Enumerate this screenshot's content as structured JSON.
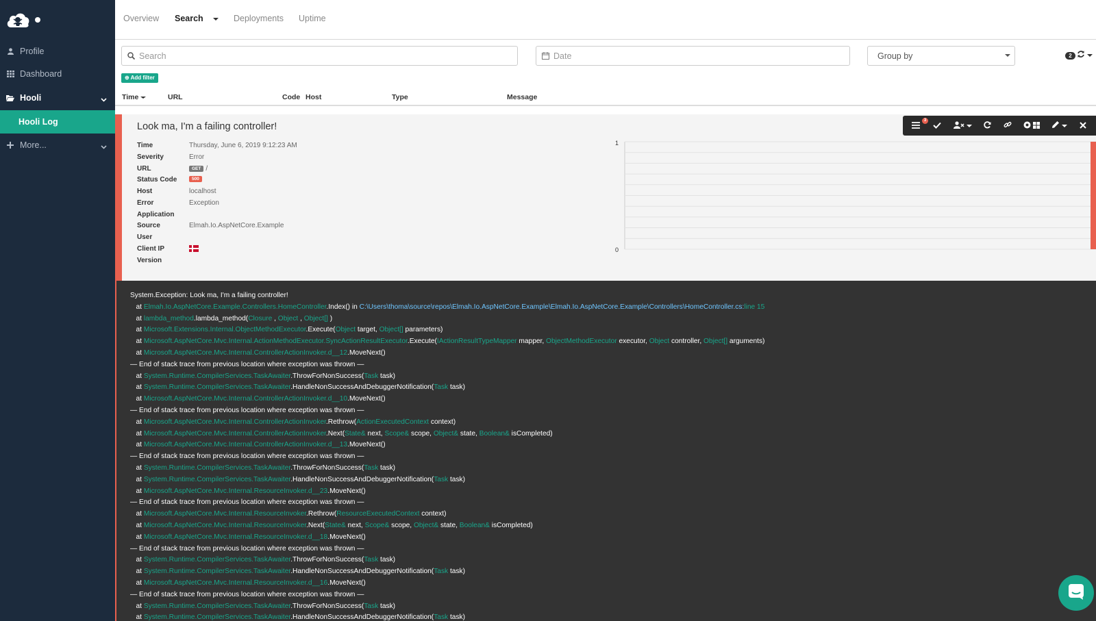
{
  "colors": {
    "sidebar_bg": "#1c2b3d",
    "accent": "#19a68b",
    "error": "#e8604f",
    "stack_bg": "#333333"
  },
  "sidebar": {
    "items": [
      {
        "label": "Profile",
        "icon": "user-icon"
      },
      {
        "label": "Dashboard",
        "icon": "grid-icon"
      },
      {
        "label": "Hooli",
        "icon": "folder-open-icon"
      },
      {
        "label": "Hooli Log",
        "active": true
      },
      {
        "label": "More...",
        "icon": "plus-icon"
      }
    ]
  },
  "header": {
    "tabs": [
      {
        "label": "Overview"
      },
      {
        "label": "Search",
        "active": true
      },
      {
        "label": "Deployments"
      },
      {
        "label": "Uptime"
      }
    ]
  },
  "filters": {
    "search_placeholder": "Search",
    "date_placeholder": "Date",
    "group_by": "Group by",
    "count": "2",
    "add_filter": "Add filter"
  },
  "table": {
    "columns": [
      "Time",
      "URL",
      "Code",
      "Host",
      "Type",
      "Message"
    ]
  },
  "toolbar": {
    "badge": "3"
  },
  "log": {
    "title": "Look ma, I'm a failing controller!",
    "fields": [
      {
        "label": "Time",
        "value": "Thursday, June 6, 2019 9:12:23 AM"
      },
      {
        "label": "Severity",
        "value": "Error"
      },
      {
        "label": "URL",
        "method": "GET",
        "value": "/"
      },
      {
        "label": "Status Code",
        "badge": "500"
      },
      {
        "label": "Host",
        "value": "localhost"
      },
      {
        "label": "Error",
        "value": "Exception"
      },
      {
        "label": "Application",
        "value": ""
      },
      {
        "label": "Source",
        "value": "Elmah.Io.AspNetCore.Example"
      },
      {
        "label": "User",
        "value": ""
      },
      {
        "label": "Client IP",
        "flag": "denmark-flag-icon"
      },
      {
        "label": "Version",
        "value": ""
      }
    ]
  },
  "chart_data": {
    "type": "bar",
    "y_ticks": [
      "1",
      "0"
    ],
    "ylim": [
      0,
      1
    ],
    "values": [
      0,
      0,
      0,
      0,
      0,
      0,
      0,
      0,
      0,
      0,
      0,
      0,
      0,
      0,
      0,
      0,
      0,
      0,
      0,
      0,
      0,
      0,
      0,
      0,
      0,
      0,
      0,
      0,
      0,
      0,
      0,
      0,
      0,
      0,
      0,
      0,
      0,
      0,
      0,
      0,
      0,
      0,
      0,
      0,
      0,
      0,
      0,
      0,
      0,
      0,
      0,
      0,
      0,
      0,
      0,
      0,
      0,
      0,
      0,
      1
    ],
    "color": "#e8604f"
  },
  "stacktrace": [
    [
      [
        "System.Exception: Look ma, I'm a failing controller!",
        ""
      ]
    ],
    [
      [
        "   at ",
        ""
      ],
      [
        "Elmah.Io.AspNetCore.Example.Controllers.HomeController",
        "t"
      ],
      [
        ".Index() in ",
        ""
      ],
      [
        "C:\\Users\\thoma\\source\\repos\\Elmah.Io.AspNetCore.Example\\Elmah.Io.AspNetCore.Example\\Controllers\\HomeController.cs:",
        "f"
      ],
      [
        "line 15",
        "t"
      ]
    ],
    [
      [
        "   at ",
        ""
      ],
      [
        "lambda_method",
        "t"
      ],
      [
        ".lambda_method(",
        ""
      ],
      [
        "Closure",
        "t"
      ],
      [
        " , ",
        ""
      ],
      [
        "Object",
        "t"
      ],
      [
        " , ",
        ""
      ],
      [
        "Object[]",
        "t"
      ],
      [
        " )",
        ""
      ]
    ],
    [
      [
        "   at ",
        ""
      ],
      [
        "Microsoft.Extensions.Internal.ObjectMethodExecutor",
        "t"
      ],
      [
        ".Execute(",
        ""
      ],
      [
        "Object",
        "t"
      ],
      [
        " target, ",
        ""
      ],
      [
        "Object[]",
        "t"
      ],
      [
        " parameters)",
        ""
      ]
    ],
    [
      [
        "   at ",
        ""
      ],
      [
        "Microsoft.AspNetCore.Mvc.Internal.ActionMethodExecutor.SyncActionResultExecutor",
        "t"
      ],
      [
        ".Execute(",
        ""
      ],
      [
        "IActionResultTypeMapper",
        "t"
      ],
      [
        " mapper, ",
        ""
      ],
      [
        "ObjectMethodExecutor",
        "t"
      ],
      [
        " executor, ",
        ""
      ],
      [
        "Object",
        "t"
      ],
      [
        " controller, ",
        ""
      ],
      [
        "Object[]",
        "t"
      ],
      [
        " arguments)",
        ""
      ]
    ],
    [
      [
        "   at ",
        ""
      ],
      [
        "Microsoft.AspNetCore.Mvc.Internal.ControllerActionInvoker.d__12",
        "t"
      ],
      [
        ".MoveNext()",
        ""
      ]
    ],
    [
      [
        "— End of stack trace from previous location where exception was thrown —",
        ""
      ]
    ],
    [
      [
        "   at ",
        ""
      ],
      [
        "System.Runtime.CompilerServices.TaskAwaiter",
        "t"
      ],
      [
        ".ThrowForNonSuccess(",
        ""
      ],
      [
        "Task",
        "t"
      ],
      [
        " task)",
        ""
      ]
    ],
    [
      [
        "   at ",
        ""
      ],
      [
        "System.Runtime.CompilerServices.TaskAwaiter",
        "t"
      ],
      [
        ".HandleNonSuccessAndDebuggerNotification(",
        ""
      ],
      [
        "Task",
        "t"
      ],
      [
        " task)",
        ""
      ]
    ],
    [
      [
        "   at ",
        ""
      ],
      [
        "Microsoft.AspNetCore.Mvc.Internal.ControllerActionInvoker.d__10",
        "t"
      ],
      [
        ".MoveNext()",
        ""
      ]
    ],
    [
      [
        "— End of stack trace from previous location where exception was thrown —",
        ""
      ]
    ],
    [
      [
        "   at ",
        ""
      ],
      [
        "Microsoft.AspNetCore.Mvc.Internal.ControllerActionInvoker",
        "t"
      ],
      [
        ".Rethrow(",
        ""
      ],
      [
        "ActionExecutedContext",
        "t"
      ],
      [
        " context)",
        ""
      ]
    ],
    [
      [
        "   at ",
        ""
      ],
      [
        "Microsoft.AspNetCore.Mvc.Internal.ControllerActionInvoker",
        "t"
      ],
      [
        ".Next(",
        ""
      ],
      [
        "State&",
        "t"
      ],
      [
        " next, ",
        ""
      ],
      [
        "Scope&",
        "t"
      ],
      [
        " scope, ",
        ""
      ],
      [
        "Object&",
        "t"
      ],
      [
        " state, ",
        ""
      ],
      [
        "Boolean&",
        "t"
      ],
      [
        " isCompleted)",
        ""
      ]
    ],
    [
      [
        "   at ",
        ""
      ],
      [
        "Microsoft.AspNetCore.Mvc.Internal.ControllerActionInvoker.d__13",
        "t"
      ],
      [
        ".MoveNext()",
        ""
      ]
    ],
    [
      [
        "— End of stack trace from previous location where exception was thrown —",
        ""
      ]
    ],
    [
      [
        "   at ",
        ""
      ],
      [
        "System.Runtime.CompilerServices.TaskAwaiter",
        "t"
      ],
      [
        ".ThrowForNonSuccess(",
        ""
      ],
      [
        "Task",
        "t"
      ],
      [
        " task)",
        ""
      ]
    ],
    [
      [
        "   at ",
        ""
      ],
      [
        "System.Runtime.CompilerServices.TaskAwaiter",
        "t"
      ],
      [
        ".HandleNonSuccessAndDebuggerNotification(",
        ""
      ],
      [
        "Task",
        "t"
      ],
      [
        " task)",
        ""
      ]
    ],
    [
      [
        "   at ",
        ""
      ],
      [
        "Microsoft.AspNetCore.Mvc.Internal.ResourceInvoker.d__23",
        "t"
      ],
      [
        ".MoveNext()",
        ""
      ]
    ],
    [
      [
        "— End of stack trace from previous location where exception was thrown —",
        ""
      ]
    ],
    [
      [
        "   at ",
        ""
      ],
      [
        "Microsoft.AspNetCore.Mvc.Internal.ResourceInvoker",
        "t"
      ],
      [
        ".Rethrow(",
        ""
      ],
      [
        "ResourceExecutedContext",
        "t"
      ],
      [
        " context)",
        ""
      ]
    ],
    [
      [
        "   at ",
        ""
      ],
      [
        "Microsoft.AspNetCore.Mvc.Internal.ResourceInvoker",
        "t"
      ],
      [
        ".Next(",
        ""
      ],
      [
        "State&",
        "t"
      ],
      [
        " next, ",
        ""
      ],
      [
        "Scope&",
        "t"
      ],
      [
        " scope, ",
        ""
      ],
      [
        "Object&",
        "t"
      ],
      [
        " state, ",
        ""
      ],
      [
        "Boolean&",
        "t"
      ],
      [
        " isCompleted)",
        ""
      ]
    ],
    [
      [
        "   at ",
        ""
      ],
      [
        "Microsoft.AspNetCore.Mvc.Internal.ResourceInvoker.d__18",
        "t"
      ],
      [
        ".MoveNext()",
        ""
      ]
    ],
    [
      [
        "— End of stack trace from previous location where exception was thrown —",
        ""
      ]
    ],
    [
      [
        "   at ",
        ""
      ],
      [
        "System.Runtime.CompilerServices.TaskAwaiter",
        "t"
      ],
      [
        ".ThrowForNonSuccess(",
        ""
      ],
      [
        "Task",
        "t"
      ],
      [
        " task)",
        ""
      ]
    ],
    [
      [
        "   at ",
        ""
      ],
      [
        "System.Runtime.CompilerServices.TaskAwaiter",
        "t"
      ],
      [
        ".HandleNonSuccessAndDebuggerNotification(",
        ""
      ],
      [
        "Task",
        "t"
      ],
      [
        " task)",
        ""
      ]
    ],
    [
      [
        "   at ",
        ""
      ],
      [
        "Microsoft.AspNetCore.Mvc.Internal.ResourceInvoker.d__16",
        "t"
      ],
      [
        ".MoveNext()",
        ""
      ]
    ],
    [
      [
        "— End of stack trace from previous location where exception was thrown —",
        ""
      ]
    ],
    [
      [
        "   at ",
        ""
      ],
      [
        "System.Runtime.CompilerServices.TaskAwaiter",
        "t"
      ],
      [
        ".ThrowForNonSuccess(",
        ""
      ],
      [
        "Task",
        "t"
      ],
      [
        " task)",
        ""
      ]
    ],
    [
      [
        "   at ",
        ""
      ],
      [
        "System.Runtime.CompilerServices.TaskAwaiter",
        "t"
      ],
      [
        ".HandleNonSuccessAndDebuggerNotification(",
        ""
      ],
      [
        "Task",
        "t"
      ],
      [
        " task)",
        ""
      ]
    ]
  ]
}
